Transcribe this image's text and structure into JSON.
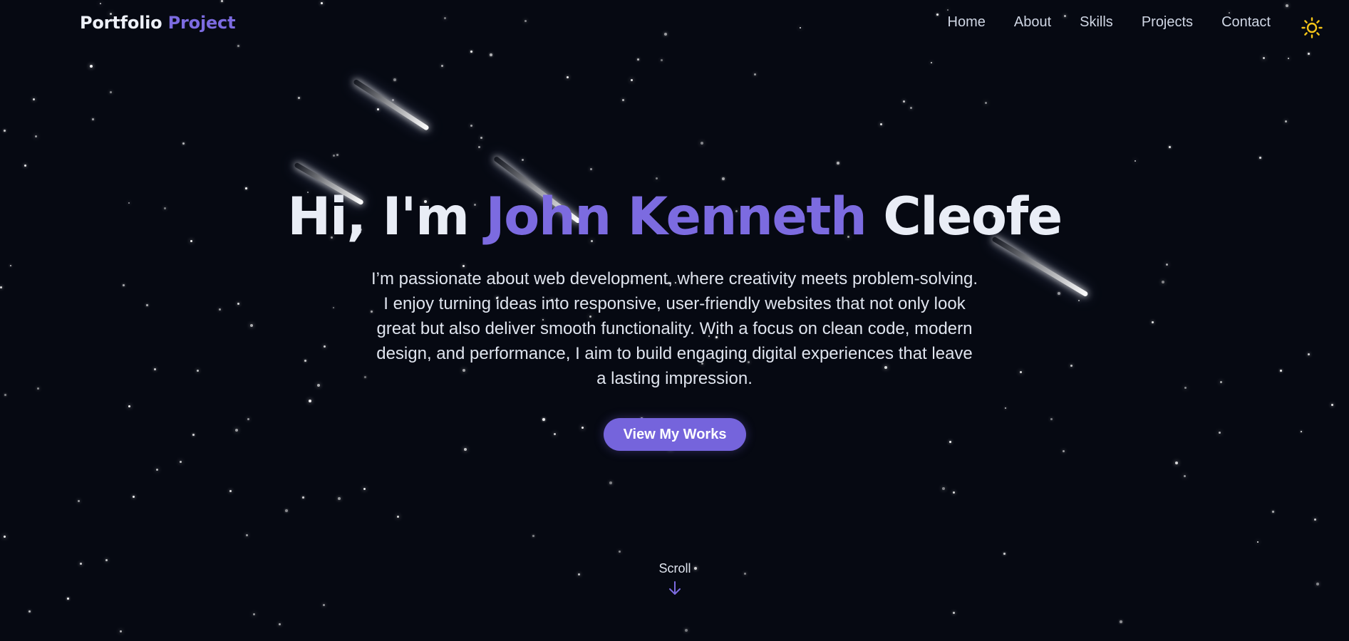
{
  "brand": {
    "name": "Portfolio",
    "accent_word": "Project"
  },
  "nav": {
    "items": [
      {
        "label": "Home"
      },
      {
        "label": "About"
      },
      {
        "label": "Skills"
      },
      {
        "label": "Projects"
      },
      {
        "label": "Contact"
      }
    ],
    "theme_toggle_icon": "sun-icon"
  },
  "hero": {
    "greeting": "Hi, I'm",
    "first_names": "John Kenneth",
    "last_name": "Cleofe",
    "description": "I’m passionate about web development, where creativity meets problem-solving. I enjoy turning ideas into responsive, user-friendly websites that not only look great but also deliver smooth functionality. With a focus on clean code, modern design, and performance, I aim to build engaging digital experiences that leave a lasting impression.",
    "cta_label": "View My Works"
  },
  "scroll": {
    "label": "Scroll",
    "icon": "arrow-down-icon"
  },
  "colors": {
    "background": "#060912",
    "accent": "#7c6be0",
    "button": "#7564dc",
    "sun": "#f5c518",
    "text": "#e9edf6"
  },
  "background_decor": {
    "icon": "starfield",
    "meteor_icon": "meteor"
  }
}
